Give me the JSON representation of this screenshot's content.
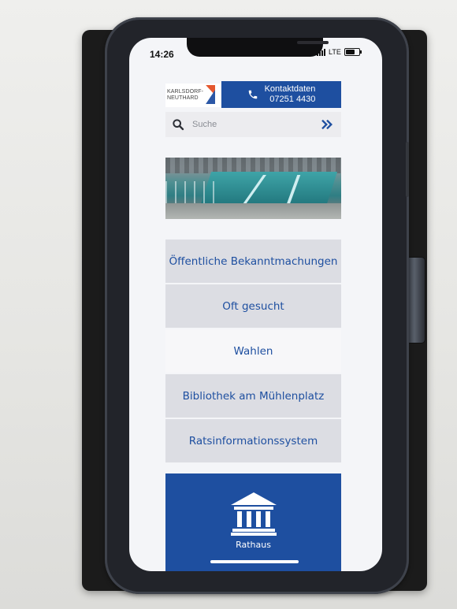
{
  "status_bar": {
    "time": "14:26",
    "network": "LTE",
    "battery_level": 0.7
  },
  "header": {
    "logo_line1": "KARLSDORF-",
    "logo_line2": "NEUTHARD",
    "contact_label": "Kontaktdaten",
    "contact_phone": "07251 4430"
  },
  "search": {
    "placeholder": "Suche"
  },
  "menu": [
    {
      "label": "Öffentliche Bekanntmachungen"
    },
    {
      "label": "Oft gesucht"
    },
    {
      "label": "Wahlen"
    },
    {
      "label": "Bibliothek am Mühlenplatz"
    },
    {
      "label": "Ratsinformationssystem"
    }
  ],
  "tile": {
    "label": "Rathaus"
  },
  "colors": {
    "brand_blue": "#1e4fa0",
    "logo_orange": "#e4572e"
  }
}
